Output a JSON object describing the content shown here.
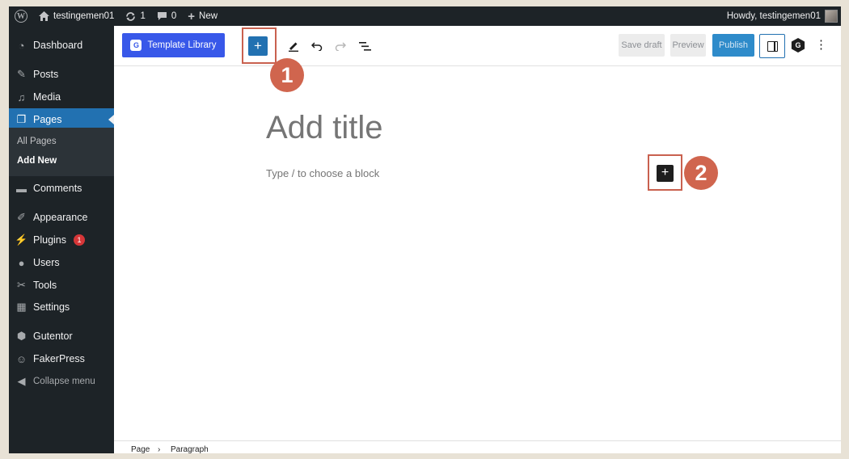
{
  "admin_bar": {
    "site_name": "testingemen01",
    "updates_count": "1",
    "comments_count": "0",
    "new_label": "New",
    "howdy": "Howdy, testingemen01"
  },
  "sidebar": {
    "dashboard": "Dashboard",
    "posts": "Posts",
    "media": "Media",
    "pages": "Pages",
    "pages_sub": [
      "All Pages",
      "Add New"
    ],
    "comments": "Comments",
    "appearance": "Appearance",
    "plugins": "Plugins",
    "plugins_badge": "1",
    "users": "Users",
    "tools": "Tools",
    "settings": "Settings",
    "gutentor": "Gutentor",
    "fakerpress": "FakerPress",
    "collapse": "Collapse menu"
  },
  "toolbar": {
    "template_library": "Template Library",
    "save_draft": "Save draft",
    "preview": "Preview",
    "publish": "Publish",
    "gutentor_badge": "G"
  },
  "editor": {
    "title_placeholder": "Add title",
    "block_placeholder": "Type / to choose a block"
  },
  "footer": {
    "breadcrumb": [
      "Page",
      "Paragraph"
    ]
  },
  "annotations": {
    "marker_1": "1",
    "marker_2": "2"
  },
  "icons": {
    "wp_logo": "wordpress-logo-icon",
    "home": "home-icon",
    "updates": "updates-icon",
    "comments": "comment-icon",
    "new": "plus-icon",
    "inserter": "plus-icon",
    "edit": "pencil-icon",
    "undo": "undo-icon",
    "redo": "redo-icon",
    "list_view": "list-view-icon",
    "settings_panel": "sidebar-panel-icon",
    "options": "vertical-ellipsis-icon"
  },
  "colors": {
    "admin_dark": "#1d2327",
    "wp_blue": "#2271b1",
    "template_library_blue": "#3858e9",
    "annotation": "#d0654e",
    "page_background": "#e8e2d6"
  }
}
